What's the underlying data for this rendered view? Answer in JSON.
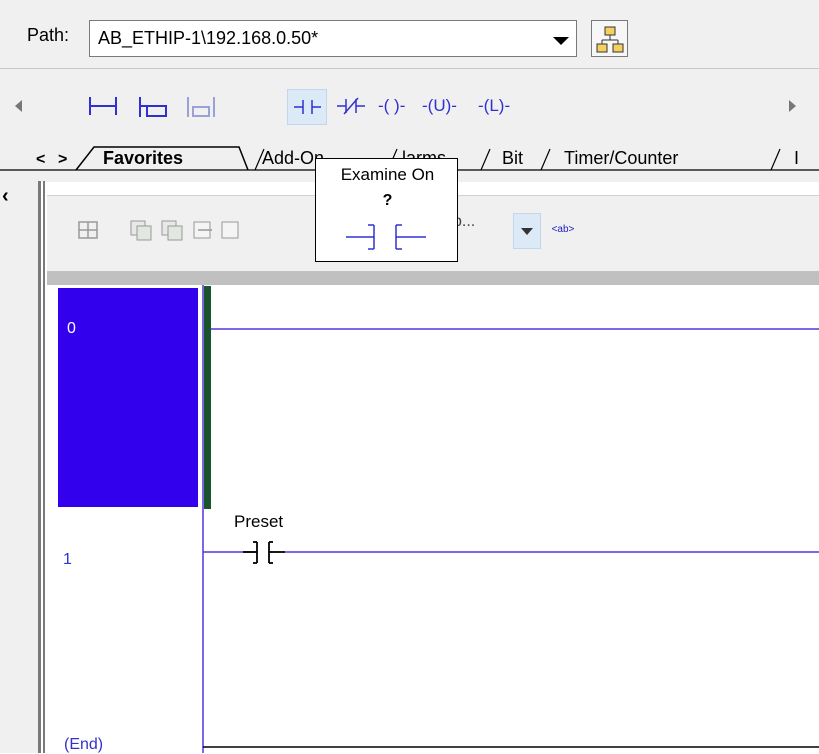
{
  "path_bar": {
    "label": "Path:",
    "value": "AB_ETHIP-1\\192.168.0.50*"
  },
  "instruction_toolbar": {
    "tools": [
      "rung",
      "branch",
      "branch-level",
      "examine-on",
      "examine-off",
      "output-energize",
      "output-unlatch",
      "output-latch"
    ],
    "coil_labels": {
      "ote": "-( )-",
      "otu": "-(U)-",
      "otl": "-(L)-"
    },
    "tabs": {
      "prev": "<",
      "next": ">",
      "items": [
        "Favorites",
        "Add-On",
        "Alarms",
        "Bit",
        "Timer/Counter",
        "I"
      ]
    }
  },
  "tooltip": {
    "title": "Examine On",
    "operand": "?"
  },
  "ladder_toolbar": {
    "rung_search_text": "b...",
    "ab_label": "<ab>"
  },
  "ladder": {
    "rungs": [
      {
        "number": "0",
        "selected": true
      },
      {
        "number": "1",
        "contact_tag": "Preset"
      }
    ],
    "end_label": "(End)"
  },
  "colors": {
    "selection": "#3300ee",
    "rail": "#5533dd",
    "rung_number": "#3333cc"
  }
}
